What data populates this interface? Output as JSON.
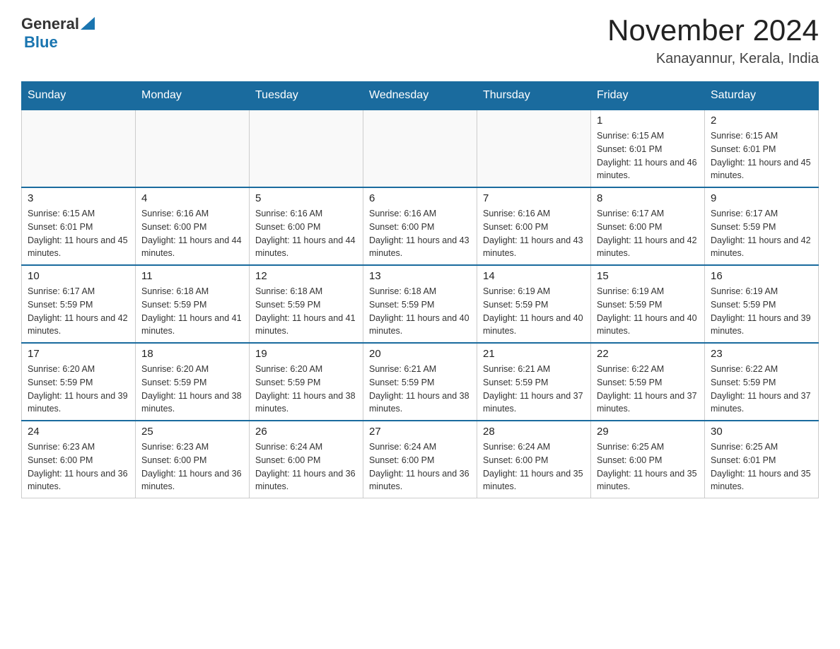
{
  "logo": {
    "general": "General",
    "blue": "Blue"
  },
  "title": {
    "month_year": "November 2024",
    "location": "Kanayannur, Kerala, India"
  },
  "header_days": [
    "Sunday",
    "Monday",
    "Tuesday",
    "Wednesday",
    "Thursday",
    "Friday",
    "Saturday"
  ],
  "weeks": [
    [
      {
        "day": "",
        "info": ""
      },
      {
        "day": "",
        "info": ""
      },
      {
        "day": "",
        "info": ""
      },
      {
        "day": "",
        "info": ""
      },
      {
        "day": "",
        "info": ""
      },
      {
        "day": "1",
        "info": "Sunrise: 6:15 AM\nSunset: 6:01 PM\nDaylight: 11 hours and 46 minutes."
      },
      {
        "day": "2",
        "info": "Sunrise: 6:15 AM\nSunset: 6:01 PM\nDaylight: 11 hours and 45 minutes."
      }
    ],
    [
      {
        "day": "3",
        "info": "Sunrise: 6:15 AM\nSunset: 6:01 PM\nDaylight: 11 hours and 45 minutes."
      },
      {
        "day": "4",
        "info": "Sunrise: 6:16 AM\nSunset: 6:00 PM\nDaylight: 11 hours and 44 minutes."
      },
      {
        "day": "5",
        "info": "Sunrise: 6:16 AM\nSunset: 6:00 PM\nDaylight: 11 hours and 44 minutes."
      },
      {
        "day": "6",
        "info": "Sunrise: 6:16 AM\nSunset: 6:00 PM\nDaylight: 11 hours and 43 minutes."
      },
      {
        "day": "7",
        "info": "Sunrise: 6:16 AM\nSunset: 6:00 PM\nDaylight: 11 hours and 43 minutes."
      },
      {
        "day": "8",
        "info": "Sunrise: 6:17 AM\nSunset: 6:00 PM\nDaylight: 11 hours and 42 minutes."
      },
      {
        "day": "9",
        "info": "Sunrise: 6:17 AM\nSunset: 5:59 PM\nDaylight: 11 hours and 42 minutes."
      }
    ],
    [
      {
        "day": "10",
        "info": "Sunrise: 6:17 AM\nSunset: 5:59 PM\nDaylight: 11 hours and 42 minutes."
      },
      {
        "day": "11",
        "info": "Sunrise: 6:18 AM\nSunset: 5:59 PM\nDaylight: 11 hours and 41 minutes."
      },
      {
        "day": "12",
        "info": "Sunrise: 6:18 AM\nSunset: 5:59 PM\nDaylight: 11 hours and 41 minutes."
      },
      {
        "day": "13",
        "info": "Sunrise: 6:18 AM\nSunset: 5:59 PM\nDaylight: 11 hours and 40 minutes."
      },
      {
        "day": "14",
        "info": "Sunrise: 6:19 AM\nSunset: 5:59 PM\nDaylight: 11 hours and 40 minutes."
      },
      {
        "day": "15",
        "info": "Sunrise: 6:19 AM\nSunset: 5:59 PM\nDaylight: 11 hours and 40 minutes."
      },
      {
        "day": "16",
        "info": "Sunrise: 6:19 AM\nSunset: 5:59 PM\nDaylight: 11 hours and 39 minutes."
      }
    ],
    [
      {
        "day": "17",
        "info": "Sunrise: 6:20 AM\nSunset: 5:59 PM\nDaylight: 11 hours and 39 minutes."
      },
      {
        "day": "18",
        "info": "Sunrise: 6:20 AM\nSunset: 5:59 PM\nDaylight: 11 hours and 38 minutes."
      },
      {
        "day": "19",
        "info": "Sunrise: 6:20 AM\nSunset: 5:59 PM\nDaylight: 11 hours and 38 minutes."
      },
      {
        "day": "20",
        "info": "Sunrise: 6:21 AM\nSunset: 5:59 PM\nDaylight: 11 hours and 38 minutes."
      },
      {
        "day": "21",
        "info": "Sunrise: 6:21 AM\nSunset: 5:59 PM\nDaylight: 11 hours and 37 minutes."
      },
      {
        "day": "22",
        "info": "Sunrise: 6:22 AM\nSunset: 5:59 PM\nDaylight: 11 hours and 37 minutes."
      },
      {
        "day": "23",
        "info": "Sunrise: 6:22 AM\nSunset: 5:59 PM\nDaylight: 11 hours and 37 minutes."
      }
    ],
    [
      {
        "day": "24",
        "info": "Sunrise: 6:23 AM\nSunset: 6:00 PM\nDaylight: 11 hours and 36 minutes."
      },
      {
        "day": "25",
        "info": "Sunrise: 6:23 AM\nSunset: 6:00 PM\nDaylight: 11 hours and 36 minutes."
      },
      {
        "day": "26",
        "info": "Sunrise: 6:24 AM\nSunset: 6:00 PM\nDaylight: 11 hours and 36 minutes."
      },
      {
        "day": "27",
        "info": "Sunrise: 6:24 AM\nSunset: 6:00 PM\nDaylight: 11 hours and 36 minutes."
      },
      {
        "day": "28",
        "info": "Sunrise: 6:24 AM\nSunset: 6:00 PM\nDaylight: 11 hours and 35 minutes."
      },
      {
        "day": "29",
        "info": "Sunrise: 6:25 AM\nSunset: 6:00 PM\nDaylight: 11 hours and 35 minutes."
      },
      {
        "day": "30",
        "info": "Sunrise: 6:25 AM\nSunset: 6:01 PM\nDaylight: 11 hours and 35 minutes."
      }
    ]
  ]
}
